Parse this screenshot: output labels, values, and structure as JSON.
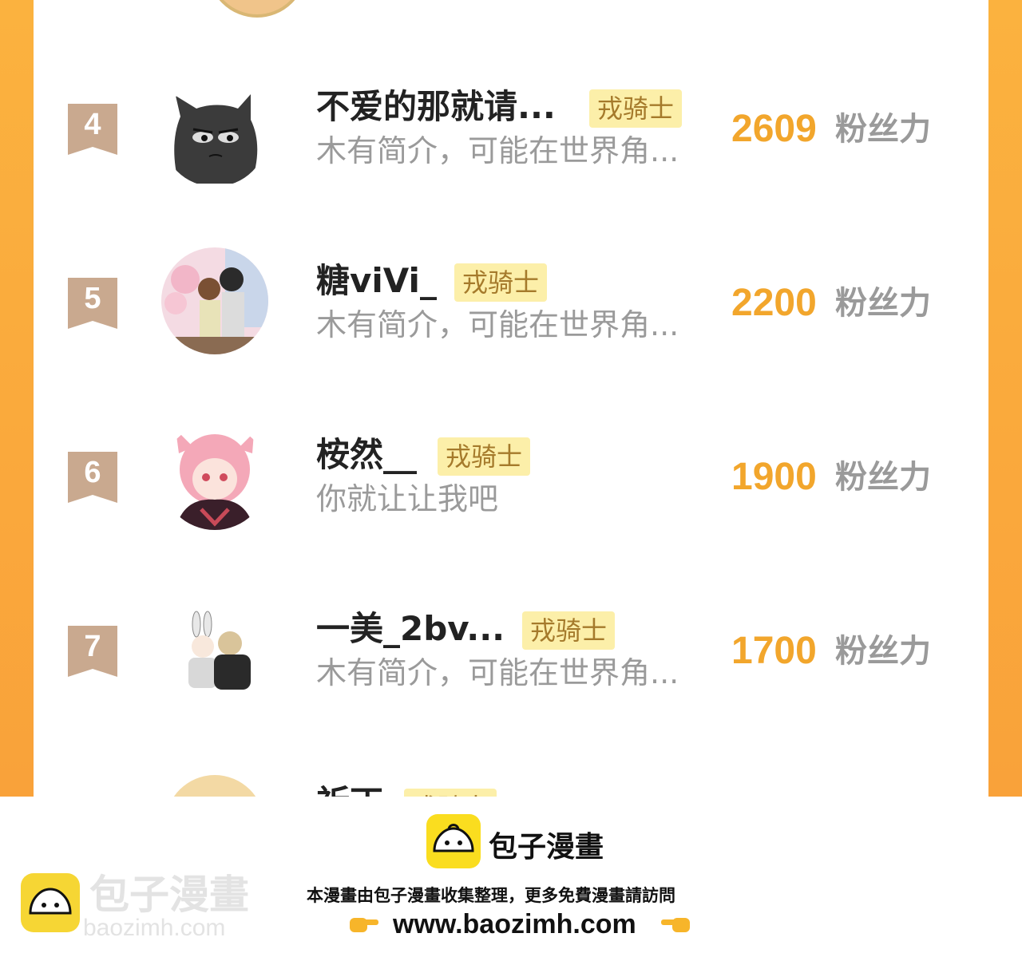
{
  "theme": {
    "accent": "#f2a62c",
    "frame": "#f9a23a",
    "badge_bg": "#fcefa9",
    "badge_text": "#a57a2b",
    "rank_color": "#c9a98f"
  },
  "leaderboard": {
    "rows": [
      {
        "rank": "4",
        "name": "不爱的那就请...",
        "badge": "戎骑士",
        "desc": "木有简介，可能在世界角...",
        "score": "2609",
        "unit": "粉丝力",
        "avatar_icon": "black-cat-avatar"
      },
      {
        "rank": "5",
        "name": "糖viVi_",
        "badge": "戎骑士",
        "desc": "木有简介，可能在世界角...",
        "score": "2200",
        "unit": "粉丝力",
        "avatar_icon": "anime-couple-avatar"
      },
      {
        "rank": "6",
        "name": "桉然__",
        "badge": "戎骑士",
        "desc": "你就让让我吧",
        "score": "1900",
        "unit": "粉丝力",
        "avatar_icon": "pink-hair-anime-avatar"
      },
      {
        "rank": "7",
        "name": "一美_2bv...",
        "badge": "戎骑士",
        "desc": "木有简介，可能在世界角...",
        "score": "1700",
        "unit": "粉丝力",
        "avatar_icon": "bunny-chibi-avatar"
      },
      {
        "rank": "",
        "name": "祈丁",
        "badge": "戎骑士",
        "desc": "",
        "score": "",
        "unit": "",
        "avatar_icon": "blonde-anime-avatar"
      }
    ]
  },
  "footer": {
    "brand": "包子漫畫",
    "notice": "本漫畫由包子漫畫收集整理，更多免費漫畫請訪問",
    "url": "www.baozimh.com",
    "watermark_brand": "包子漫畫",
    "watermark_url": "baozimh.com",
    "hand_left_icon": "pointing-right-hand-icon",
    "hand_right_icon": "pointing-left-hand-icon"
  }
}
